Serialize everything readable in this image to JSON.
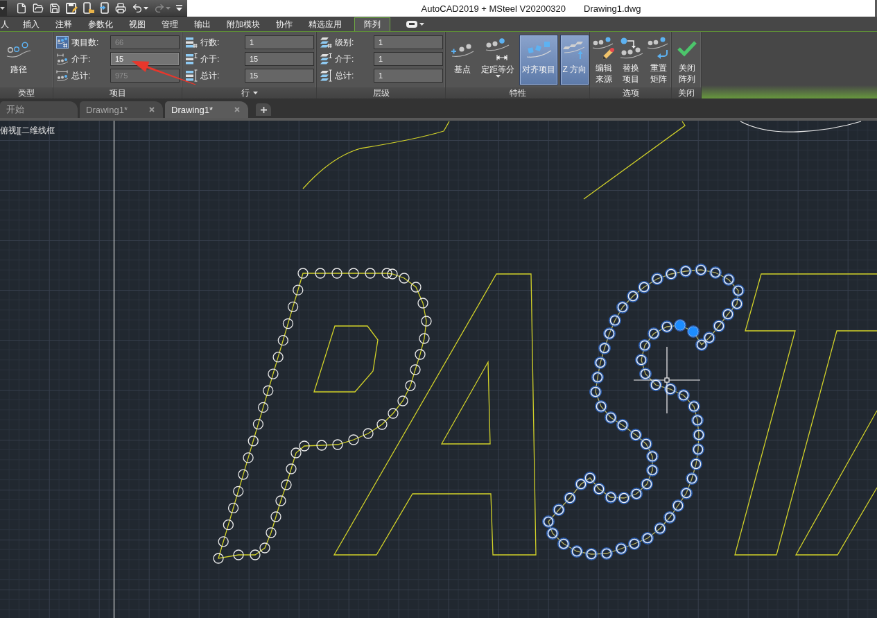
{
  "window": {
    "title": "AutoCAD2019 + MSteel V20200320",
    "document": "Drawing1.dwg"
  },
  "quick_access_toolbar": [
    {
      "kind": "new",
      "disabled": false
    },
    {
      "kind": "open",
      "disabled": false
    },
    {
      "kind": "save",
      "disabled": false
    },
    {
      "kind": "save_as",
      "disabled": false
    },
    {
      "kind": "open_mobile",
      "disabled": false
    },
    {
      "kind": "save_mobile",
      "disabled": false
    },
    {
      "kind": "print",
      "disabled": false
    },
    {
      "kind": "undo",
      "disabled": false
    },
    {
      "kind": "redo",
      "disabled": true
    },
    {
      "kind": "customize",
      "disabled": false
    }
  ],
  "ribbon_tabs": [
    {
      "label": "人",
      "selected": false
    },
    {
      "label": "插入",
      "selected": false
    },
    {
      "label": "注释",
      "selected": false
    },
    {
      "label": "参数化",
      "selected": false
    },
    {
      "label": "视图",
      "selected": false
    },
    {
      "label": "管理",
      "selected": false
    },
    {
      "label": "输出",
      "selected": false
    },
    {
      "label": "附加模块",
      "selected": false
    },
    {
      "label": "协作",
      "selected": false
    },
    {
      "label": "精选应用",
      "selected": false
    },
    {
      "label": "阵列",
      "selected": true
    }
  ],
  "ribbon_panels": [
    {
      "kind": "buttons",
      "title": "类型",
      "dropdown": false,
      "buttons": [
        {
          "label": "路径",
          "selected": false,
          "dropdown": false
        }
      ]
    },
    {
      "kind": "fields",
      "title": "项目",
      "dropdown": false,
      "fields": [
        {
          "label": "项目数:",
          "value": "66",
          "disabled": true,
          "focused": false
        },
        {
          "label": "介于:",
          "value": "15",
          "disabled": false,
          "focused": true
        },
        {
          "label": "总计:",
          "value": "975",
          "disabled": true,
          "focused": false
        }
      ]
    },
    {
      "kind": "fields",
      "title": "行",
      "dropdown": true,
      "fields": [
        {
          "label": "行数:",
          "value": "1",
          "disabled": false,
          "focused": false
        },
        {
          "label": "介于:",
          "value": "15",
          "disabled": false,
          "focused": false
        },
        {
          "label": "总计:",
          "value": "15",
          "disabled": false,
          "focused": false
        }
      ]
    },
    {
      "kind": "fields",
      "title": "层级",
      "dropdown": false,
      "fields": [
        {
          "label": "级别:",
          "value": "1",
          "disabled": false,
          "focused": false
        },
        {
          "label": "介于:",
          "value": "1",
          "disabled": false,
          "focused": false
        },
        {
          "label": "总计:",
          "value": "1",
          "disabled": false,
          "focused": false
        }
      ]
    },
    {
      "kind": "buttons",
      "title": "特性",
      "dropdown": false,
      "buttons": [
        {
          "label": "基点",
          "selected": false,
          "dropdown": false
        },
        {
          "label": "定距等分",
          "selected": false,
          "dropdown": true
        },
        {
          "label": "对齐项目",
          "selected": true,
          "dropdown": false
        },
        {
          "label": "Z 方向",
          "selected": true,
          "dropdown": false
        }
      ]
    },
    {
      "kind": "stacked_buttons",
      "title": "选项",
      "dropdown": false,
      "buttons": [
        {
          "label": "编辑来源",
          "selected": false
        },
        {
          "label": "替换项目",
          "selected": false
        },
        {
          "label": "重置矩阵",
          "selected": false
        }
      ]
    },
    {
      "kind": "stacked_buttons",
      "title": "关闭",
      "dropdown": false,
      "buttons": [
        {
          "label": "关闭阵列",
          "selected": false
        }
      ]
    }
  ],
  "document_tabs": [
    {
      "label": "开始",
      "selected": false,
      "closable": false
    },
    {
      "label": "Drawing1*",
      "selected": false,
      "closable": true
    },
    {
      "label": "Drawing1*",
      "selected": true,
      "closable": true
    }
  ],
  "viewport": {
    "label": "俯视][二维线框"
  }
}
